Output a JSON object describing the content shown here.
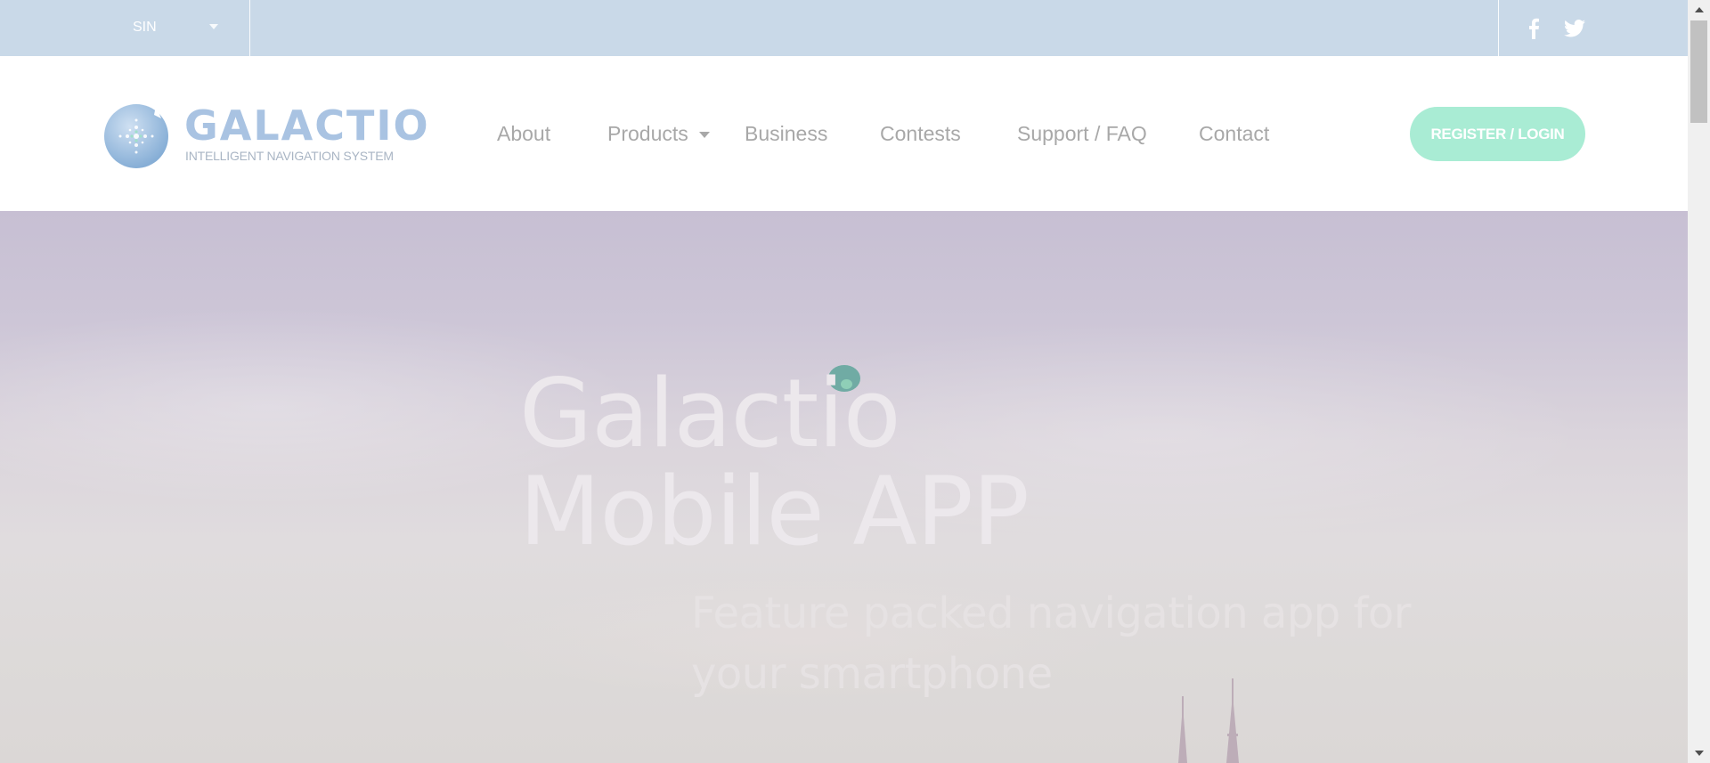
{
  "topbar": {
    "language": "SIN",
    "social": {
      "facebook_icon": "facebook-icon",
      "twitter_icon": "twitter-icon"
    }
  },
  "header": {
    "logo": {
      "name": "GALACTIO",
      "tagline": "INTELLIGENT NAVIGATION SYSTEM",
      "icon": "globe-compass-icon"
    },
    "nav": [
      {
        "label": "About"
      },
      {
        "label": "Products",
        "has_dropdown": true
      },
      {
        "label": "Business"
      },
      {
        "label": "Contests"
      },
      {
        "label": "Support / FAQ"
      },
      {
        "label": "Contact"
      }
    ],
    "register_label": "REGISTER / LOGIN"
  },
  "hero": {
    "title_line1": "Galactio",
    "title_line2": "Mobile APP",
    "subtitle_line1": "Feature packed navigation app for",
    "subtitle_line2": "your smartphone"
  },
  "colors": {
    "topbar_bg": "#c9d9e8",
    "accent_button": "#a9ecd4",
    "logo_blue": "#a9c3e2",
    "nav_text": "#a8a8a8"
  }
}
